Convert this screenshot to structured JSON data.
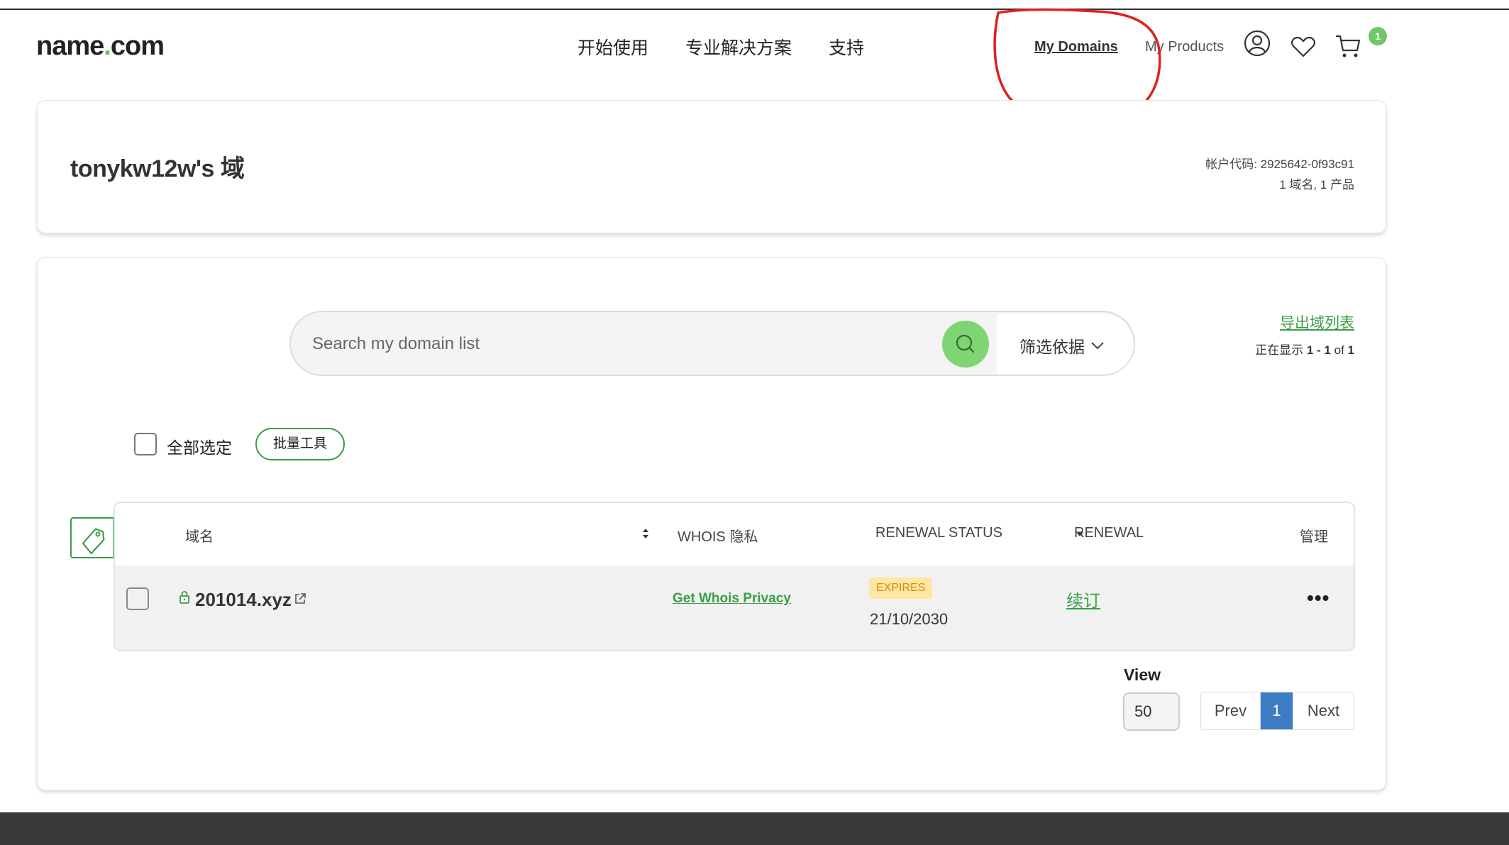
{
  "header": {
    "logo_prefix": "name",
    "logo_dot": ".",
    "logo_suffix": "com",
    "nav": [
      "开始使用",
      "专业解决方案",
      "支持"
    ],
    "my_domains": "My Domains",
    "my_products": "My Products",
    "cart_count": "1"
  },
  "account": {
    "title": "tonykw12w's 域",
    "code": "帐户代码: 2925642-0f93c91",
    "counts": "1 域名, 1 产品"
  },
  "search": {
    "placeholder": "Search my domain list",
    "filter_label": "筛选依据"
  },
  "list_meta": {
    "export_label": "导出域列表",
    "showing_prefix": "正在显示 ",
    "showing_range": "1 - 1",
    "showing_of": " of ",
    "showing_total": "1"
  },
  "bulk": {
    "select_all": "全部选定",
    "tools": "批量工具"
  },
  "table": {
    "headers": {
      "domain": "域名",
      "whois": "WHOIS 隐私",
      "renewal_status": "RENEWAL STATUS",
      "renewal": "RENEWAL",
      "manage": "管理"
    },
    "rows": [
      {
        "domain": "201014.xyz",
        "whois": "Get Whois Privacy",
        "status_badge": "EXPIRES",
        "expiry_date": "21/10/2030",
        "renew": "续订",
        "more": "•••"
      }
    ]
  },
  "pagination": {
    "view_label": "View",
    "page_size": "50",
    "prev": "Prev",
    "current": "1",
    "next": "Next"
  },
  "colors": {
    "brand_green": "#65c05a",
    "link_green": "#3a9e45",
    "pager_active": "#3e7cc3",
    "annotation_red": "#e02020"
  },
  "icons": [
    "user-icon",
    "heart-icon",
    "cart-icon",
    "search-icon",
    "chevron-down-icon",
    "tag-icon",
    "lock-icon",
    "external-link-icon",
    "sort-icon",
    "dropdown-caret-icon",
    "more-icon"
  ]
}
